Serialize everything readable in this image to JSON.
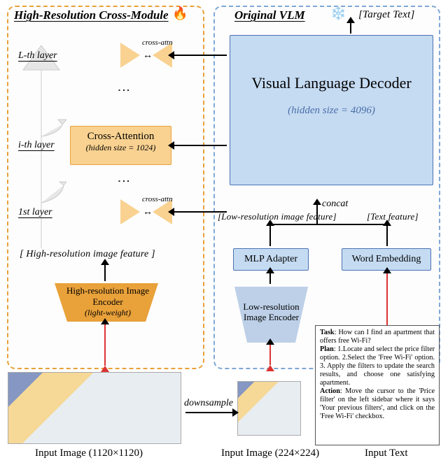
{
  "domain": "Diagram",
  "title_hr_module": "High-Resolution Cross-Module",
  "title_vlm": "Original VLM",
  "icons": {
    "fire": "🔥",
    "snow": "❄️"
  },
  "decoder": {
    "label": "Visual Language Decoder",
    "sub": "(hidden size = 4096)"
  },
  "cross_attn": {
    "label": "Cross-Attention",
    "sub": "(hidden size = 1024)",
    "side_label": "cross-attn"
  },
  "layers": {
    "L": "L-th layer",
    "i": "i-th layer",
    "first": "1st layer"
  },
  "hr_encoder": {
    "label": "High-resolution Image Encoder",
    "sub": "(light-weight)"
  },
  "lr_encoder": {
    "label": "Low-resolution Image Encoder"
  },
  "mlp": "MLP Adapter",
  "word_embedding": "Word Embedding",
  "feature_labels": {
    "hr": "[ High-resolution image feature ]",
    "lr": "[Low-resolution image feature]",
    "text": "[Text feature]",
    "target": "[Target Text]",
    "concat": "concat"
  },
  "downsample": "downsample",
  "captions": {
    "input_large": "Input Image (1120×1120)",
    "input_small": "Input Image (224×224)",
    "input_text": "Input Text"
  },
  "input_text": {
    "task_key": "Task",
    "task": "How can I find an apartment that offers free Wi-Fi?",
    "plan_key": "Plan",
    "plan": "1.Locate and select the price filter option. 2.Select the 'Free Wi-Fi' option. 3. Apply the filters to update the search results, and choose one satisfying apartment.",
    "action_key": "Action",
    "action": "Move the cursor to the 'Price filter' on the left sidebar where it says 'Your previous filters', and click on the 'Free Wi-Fi' checkbox."
  },
  "colors": {
    "orange": "#e9a13a",
    "orange_fill": "#f9d291",
    "blue_border": "#4b73b2",
    "blue_fill": "#c5dbf2",
    "blue_dash": "#7fa7d6",
    "red": "#d33"
  }
}
